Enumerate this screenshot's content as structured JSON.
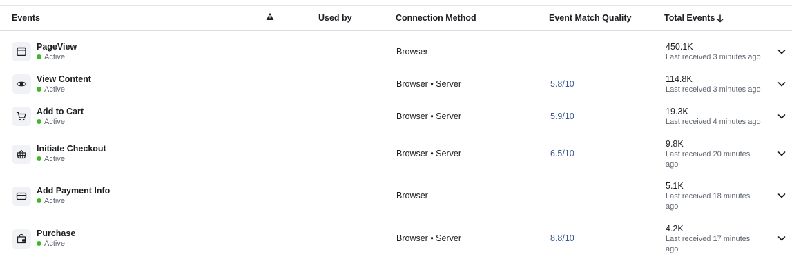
{
  "header": {
    "events": "Events",
    "warning_icon": "warning-triangle-icon",
    "used_by": "Used by",
    "connection_method": "Connection Method",
    "event_match_quality": "Event Match Quality",
    "total_events": "Total Events",
    "sort_icon": "arrow-down-icon"
  },
  "rows": [
    {
      "icon": "browser-window-icon",
      "name": "PageView",
      "status": "Active",
      "method": "Browser",
      "quality": "",
      "total": "450.1K",
      "received": "Last received 3 minutes ago"
    },
    {
      "icon": "eye-icon",
      "name": "View Content",
      "status": "Active",
      "method": "Browser • Server",
      "quality": "5.8/10",
      "total": "114.8K",
      "received": "Last received 3 minutes ago"
    },
    {
      "icon": "cart-icon",
      "name": "Add to Cart",
      "status": "Active",
      "method": "Browser • Server",
      "quality": "5.9/10",
      "total": "19.3K",
      "received": "Last received 4 minutes ago"
    },
    {
      "icon": "basket-icon",
      "name": "Initiate Checkout",
      "status": "Active",
      "method": "Browser • Server",
      "quality": "6.5/10",
      "total": "9.8K",
      "received": "Last received 20 minutes ago"
    },
    {
      "icon": "credit-card-icon",
      "name": "Add Payment Info",
      "status": "Active",
      "method": "Browser",
      "quality": "",
      "total": "5.1K",
      "received": "Last received 18 minutes ago"
    },
    {
      "icon": "shopping-bag-icon",
      "name": "Purchase",
      "status": "Active",
      "method": "Browser • Server",
      "quality": "8.8/10",
      "total": "4.2K",
      "received": "Last received 17 minutes ago"
    }
  ],
  "colors": {
    "active_dot": "#42b72a",
    "quality_link": "#385898",
    "divider": "#dadde1",
    "icon_bg": "#f0f2f5"
  }
}
